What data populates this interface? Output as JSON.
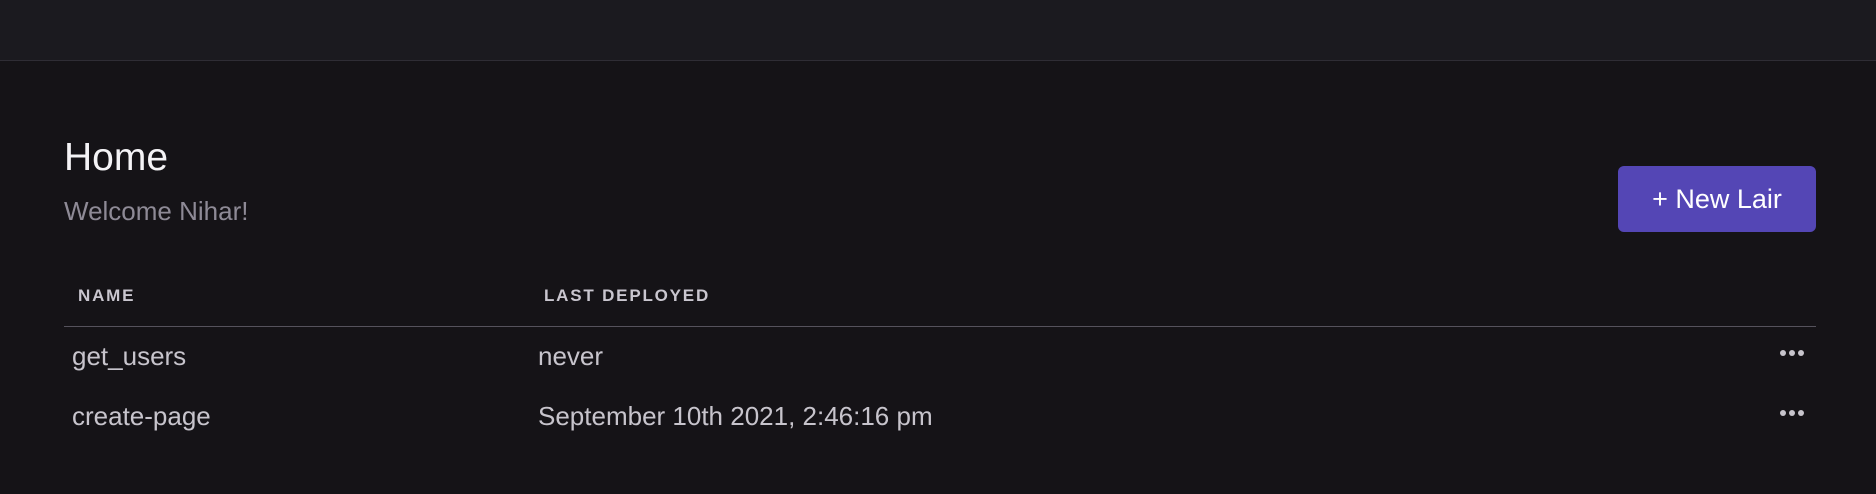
{
  "header": {
    "title": "Home",
    "subtitle": "Welcome Nihar!",
    "new_button_label": "+ New Lair"
  },
  "table": {
    "columns": [
      "NAME",
      "LAST DEPLOYED"
    ],
    "rows": [
      {
        "name": "get_users",
        "last_deployed": "never"
      },
      {
        "name": "create-page",
        "last_deployed": "September 10th 2021, 2:46:16 pm"
      }
    ]
  },
  "icons": {
    "row_menu": "ellipsis-icon"
  },
  "colors": {
    "background": "#151317",
    "topbar": "#1b1a1f",
    "accent": "#5446b5"
  }
}
